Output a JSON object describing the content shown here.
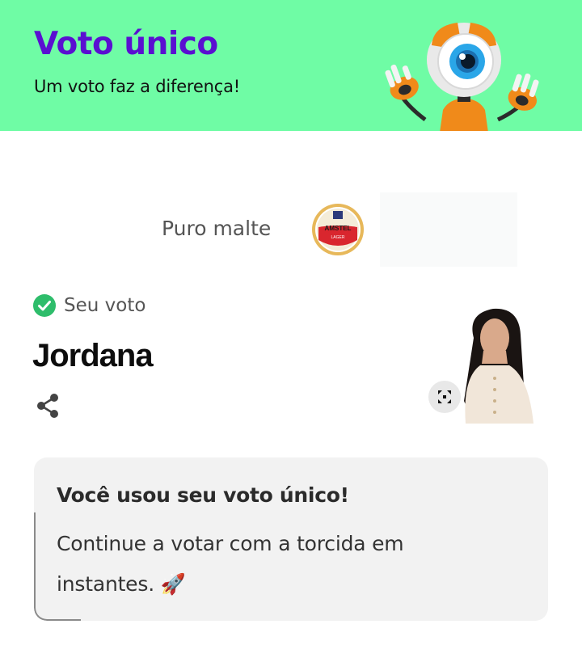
{
  "header": {
    "title": "Voto único",
    "subtitle": "Um voto faz a diferença!",
    "mascot_icon": "big-brother-eye-mascot"
  },
  "sponsor": {
    "label": "Puro malte",
    "logo_text_top": "AMSTEL",
    "logo_text_bottom": "LAGER"
  },
  "vote": {
    "label": "Seu voto",
    "candidate": "Jordana",
    "check_icon": "check-circle-icon",
    "share_icon": "share-icon",
    "expand_icon": "expand-icon"
  },
  "info": {
    "title": "Você usou seu voto único!",
    "message": "Continue a votar com a torcida em instantes. 🚀"
  },
  "colors": {
    "header_bg": "#6ffca5",
    "title": "#5a0fd1",
    "check": "#2ebd6b",
    "card_bg": "#f2f2f2"
  }
}
